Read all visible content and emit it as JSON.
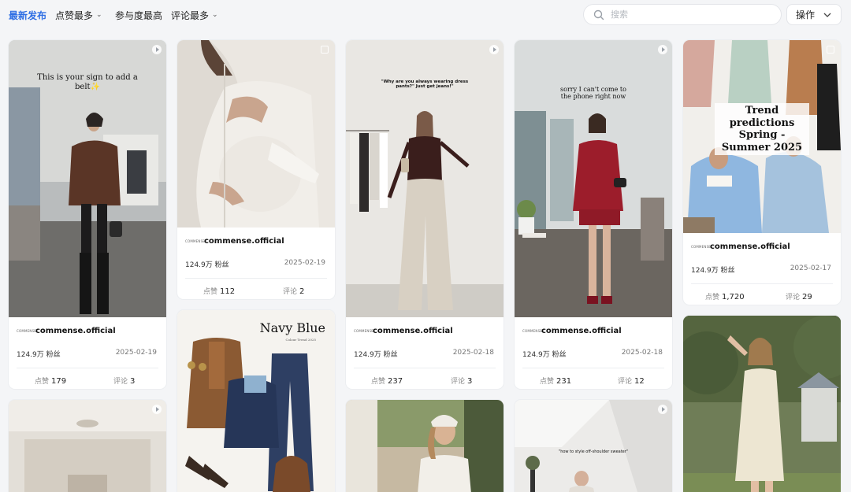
{
  "sort_tabs": [
    {
      "label": "最新发布",
      "active": true,
      "chevron": false
    },
    {
      "label": "点赞最多",
      "active": false,
      "chevron": true
    },
    {
      "label": "参与度最高",
      "active": false,
      "chevron": false
    },
    {
      "label": "评论最多",
      "active": false,
      "chevron": true
    }
  ],
  "search": {
    "placeholder": "搜索",
    "icon": "search-icon"
  },
  "action_menu": {
    "label": "操作",
    "icon": "chevron-down-icon"
  },
  "likes_label": "点赞",
  "comments_label": "评论",
  "colors": {
    "accent": "#2f6fe4",
    "page_bg": "#f4f5f7"
  },
  "posts": [
    {
      "id": "p1",
      "overlay": "This is your sign to add a belt✨",
      "account": "commense.official",
      "logo": "COMMENSE",
      "fans": "124.9万 粉丝",
      "date": "2025-02-19",
      "likes": "179",
      "comments": "3",
      "badge": "play"
    },
    {
      "id": "p2",
      "overlay": "",
      "account": "commense.official",
      "logo": "COMMENSE",
      "fans": "124.9万 粉丝",
      "date": "2025-02-19",
      "likes": "112",
      "comments": "2",
      "badge": "box"
    },
    {
      "id": "p3",
      "overlay": "\"Why are you always wearing dress pants?\" Just get jeans!\"",
      "account": "commense.official",
      "logo": "COMMENSE",
      "fans": "124.9万 粉丝",
      "date": "2025-02-18",
      "likes": "237",
      "comments": "3",
      "badge": "play"
    },
    {
      "id": "p4",
      "overlay": "sorry I can't come to the phone right now",
      "account": "commense.official",
      "logo": "COMMENSE",
      "fans": "124.9万 粉丝",
      "date": "2025-02-18",
      "likes": "231",
      "comments": "12",
      "badge": "play"
    },
    {
      "id": "p5",
      "overlay": "Trend predictions Spring - Summer 2025",
      "account": "commense.official",
      "logo": "COMMENSE",
      "fans": "124.9万 粉丝",
      "date": "2025-02-17",
      "likes": "1,720",
      "comments": "29",
      "badge": "box"
    },
    {
      "id": "p6",
      "overlay": "Navy Blue",
      "subtitle": "Colour Trend 2025",
      "badge": "none"
    },
    {
      "id": "p7",
      "overlay": "",
      "badge": "play"
    },
    {
      "id": "p8",
      "overlay": "",
      "badge": "none"
    },
    {
      "id": "p9",
      "overlay": "\"how to style off-shoulder sweater\"",
      "badge": "play"
    },
    {
      "id": "p10",
      "overlay": "",
      "badge": "none"
    }
  ]
}
